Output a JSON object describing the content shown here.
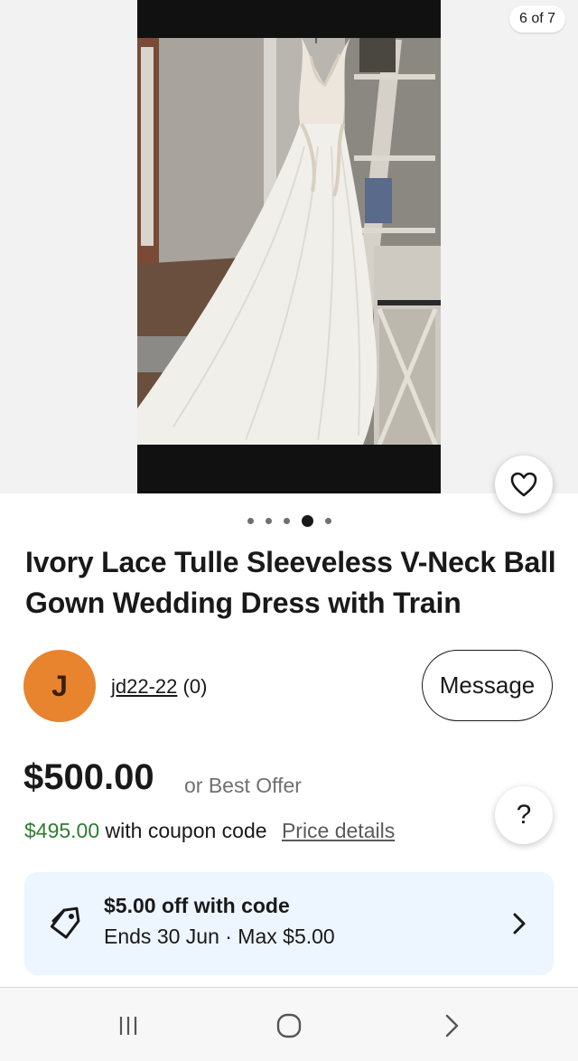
{
  "gallery": {
    "counter": "6 of 7",
    "total_images": 7,
    "current_image": 6,
    "active_dot_index": 3,
    "dot_count": 5
  },
  "listing": {
    "title": "Ivory Lace Tulle Sleeveless V-Neck Ball Gown Wedding Dress with Train"
  },
  "seller": {
    "avatar_initial": "J",
    "name": "jd22-22",
    "feedback": "(0)",
    "message_label": "Message"
  },
  "price": {
    "amount": "$500.00",
    "best_offer": "or Best Offer",
    "coupon_price": "$495.00",
    "coupon_text": "with coupon code",
    "details_link": "Price details",
    "help_label": "?"
  },
  "coupon": {
    "title": "$5.00 off with code",
    "subtitle": "Ends 30 Jun · Max $5.00"
  },
  "colors": {
    "avatar": "#e8832e",
    "coupon_price": "#2e7d32",
    "coupon_card": "#edf5fe",
    "text_primary": "#191919",
    "text_secondary": "#707070"
  },
  "icons": {
    "favorite": "heart-icon",
    "coupon": "tag-icon",
    "card_arrow": "chevron-right-icon",
    "nav_recents": "recents-icon",
    "nav_home": "home-icon",
    "nav_back": "back-icon"
  }
}
